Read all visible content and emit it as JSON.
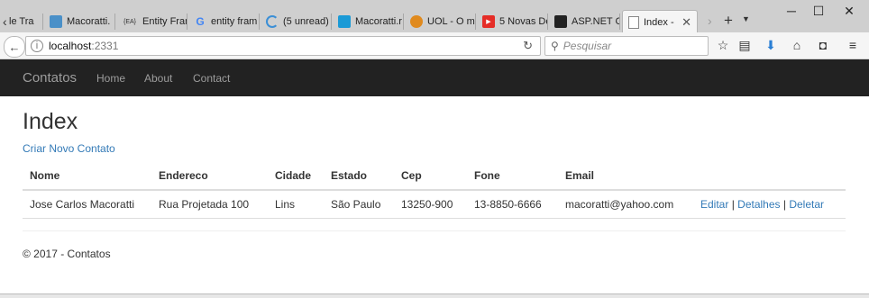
{
  "browser": {
    "tabs": [
      {
        "title": "le Tra",
        "icon": "generic"
      },
      {
        "title": "Macoratti.",
        "icon": "macoratti"
      },
      {
        "title": "Entity Fram",
        "icon": "ea"
      },
      {
        "title": "entity fram",
        "icon": "google"
      },
      {
        "title": "(5 unread)",
        "icon": "loading"
      },
      {
        "title": "Macoratti.r",
        "icon": "macoratti-blue"
      },
      {
        "title": "UOL - O m",
        "icon": "uol"
      },
      {
        "title": "5 Novas De",
        "icon": "youtube"
      },
      {
        "title": "ASP.NET C",
        "icon": "asp"
      },
      {
        "title": "Index -",
        "icon": "page"
      }
    ],
    "ea_icon_text": "{EA}",
    "new_tab": "+",
    "url_host": "localhost",
    "url_port": ":2331",
    "search_placeholder": "Pesquisar"
  },
  "app": {
    "brand": "Contatos",
    "nav": [
      "Home",
      "About",
      "Contact"
    ],
    "page_title": "Index",
    "create_link": "Criar Novo Contato",
    "table": {
      "headers": [
        "Nome",
        "Endereco",
        "Cidade",
        "Estado",
        "Cep",
        "Fone",
        "Email",
        ""
      ],
      "rows": [
        {
          "nome": "Jose Carlos Macoratti",
          "endereco": "Rua Projetada 100",
          "cidade": "Lins",
          "estado": "São Paulo",
          "cep": "13250-900",
          "fone": "13-8850-6666",
          "email": "macoratti@yahoo.com",
          "actions": {
            "edit": "Editar",
            "sep1": " | ",
            "details": "Detalhes",
            "sep2": " | ",
            "delete": "Deletar"
          }
        }
      ]
    },
    "footer": "© 2017 - Contatos"
  },
  "colors": {
    "navbar": "#222222",
    "link": "#337ab7",
    "brand": "#9d9d9d"
  }
}
